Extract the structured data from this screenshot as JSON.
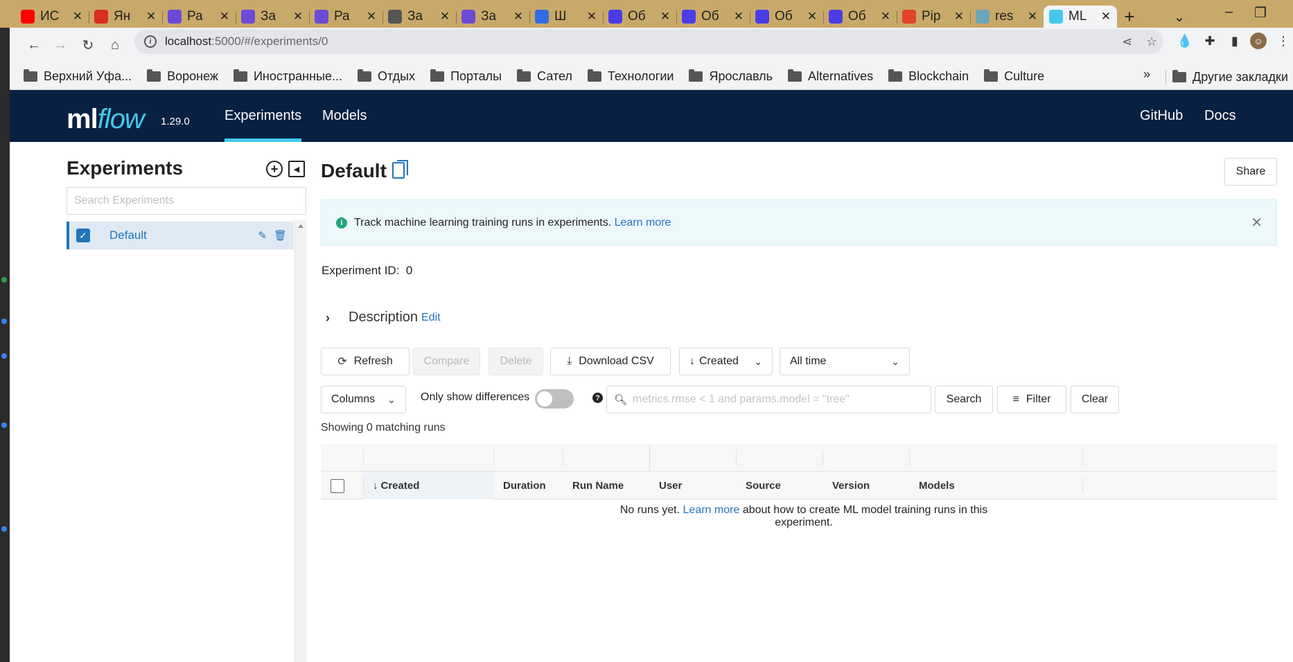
{
  "browser": {
    "tabs": [
      {
        "title": "ИС",
        "favicon": "youtube-icon",
        "color": "#ff0000"
      },
      {
        "title": "Ян",
        "favicon": "translate-icon",
        "color": "#d92d20"
      },
      {
        "title": "Ра",
        "favicon": "nodes-icon",
        "color": "#6a4bd6"
      },
      {
        "title": "За",
        "favicon": "nodes-icon",
        "color": "#6a4bd6"
      },
      {
        "title": "Ра",
        "favicon": "nodes-icon",
        "color": "#6a4bd6"
      },
      {
        "title": "За",
        "favicon": "globe-icon",
        "color": "#555555"
      },
      {
        "title": "За",
        "favicon": "nodes-icon",
        "color": "#6a4bd6"
      },
      {
        "title": "Ш",
        "favicon": "kubernetes-icon",
        "color": "#326ce5"
      },
      {
        "title": "Об",
        "favicon": "s-icon",
        "color": "#4b3ce8"
      },
      {
        "title": "Об",
        "favicon": "s-icon",
        "color": "#4b3ce8"
      },
      {
        "title": "Об",
        "favicon": "s-icon",
        "color": "#4b3ce8"
      },
      {
        "title": "Об",
        "favicon": "s-icon",
        "color": "#4b3ce8"
      },
      {
        "title": "Pip",
        "favicon": "gitlab-icon",
        "color": "#e24329"
      },
      {
        "title": "res",
        "favicon": "wave-icon",
        "color": "#6aa6b8"
      },
      {
        "title": "ML",
        "favicon": "mlflow-icon",
        "color": "#43c9ed"
      }
    ],
    "url_host": "localhost",
    "url_path": ":5000/#/experiments/0",
    "bookmarks": [
      "Верхний Уфа...",
      "Воронеж",
      "Иностранные...",
      "Отдых",
      "Порталы",
      "Сател",
      "Технологии",
      "Ярославль",
      "Alternatives",
      "Blockchain",
      "Culture"
    ],
    "bookmarks_more": "»",
    "other_bookmarks": "Другие закладки"
  },
  "header": {
    "logo_ml": "ml",
    "logo_flow": "flow",
    "version": "1.29.0",
    "nav": [
      "Experiments",
      "Models"
    ],
    "right_nav": [
      "GitHub",
      "Docs"
    ],
    "accent": "#43c9ed",
    "background": "#082142"
  },
  "sidebar": {
    "title": "Experiments",
    "search_placeholder": "Search Experiments",
    "experiments": [
      {
        "name": "Default",
        "checked": true
      }
    ]
  },
  "main": {
    "title": "Default",
    "share_label": "Share",
    "banner_text": "Track machine learning training runs in experiments.",
    "banner_link": "Learn more",
    "experiment_id_label": "Experiment ID:",
    "experiment_id": "0",
    "description_label": "Description",
    "description_edit": "Edit",
    "toolbar": {
      "refresh": "Refresh",
      "compare": "Compare",
      "delete": "Delete",
      "download_csv": "Download CSV",
      "sort": "Created",
      "time_range": "All time",
      "columns": "Columns",
      "only_diff": "Only show differences",
      "search_placeholder": "metrics.rmse < 1 and params.model = \"tree\"",
      "search": "Search",
      "filter": "Filter",
      "clear": "Clear"
    },
    "showing": "Showing 0 matching runs",
    "columns": [
      "Created",
      "Duration",
      "Run Name",
      "User",
      "Source",
      "Version",
      "Models"
    ],
    "empty_prefix": "No runs yet.",
    "empty_link": "Learn more",
    "empty_suffix": "about how to create ML model training runs in this experiment."
  }
}
